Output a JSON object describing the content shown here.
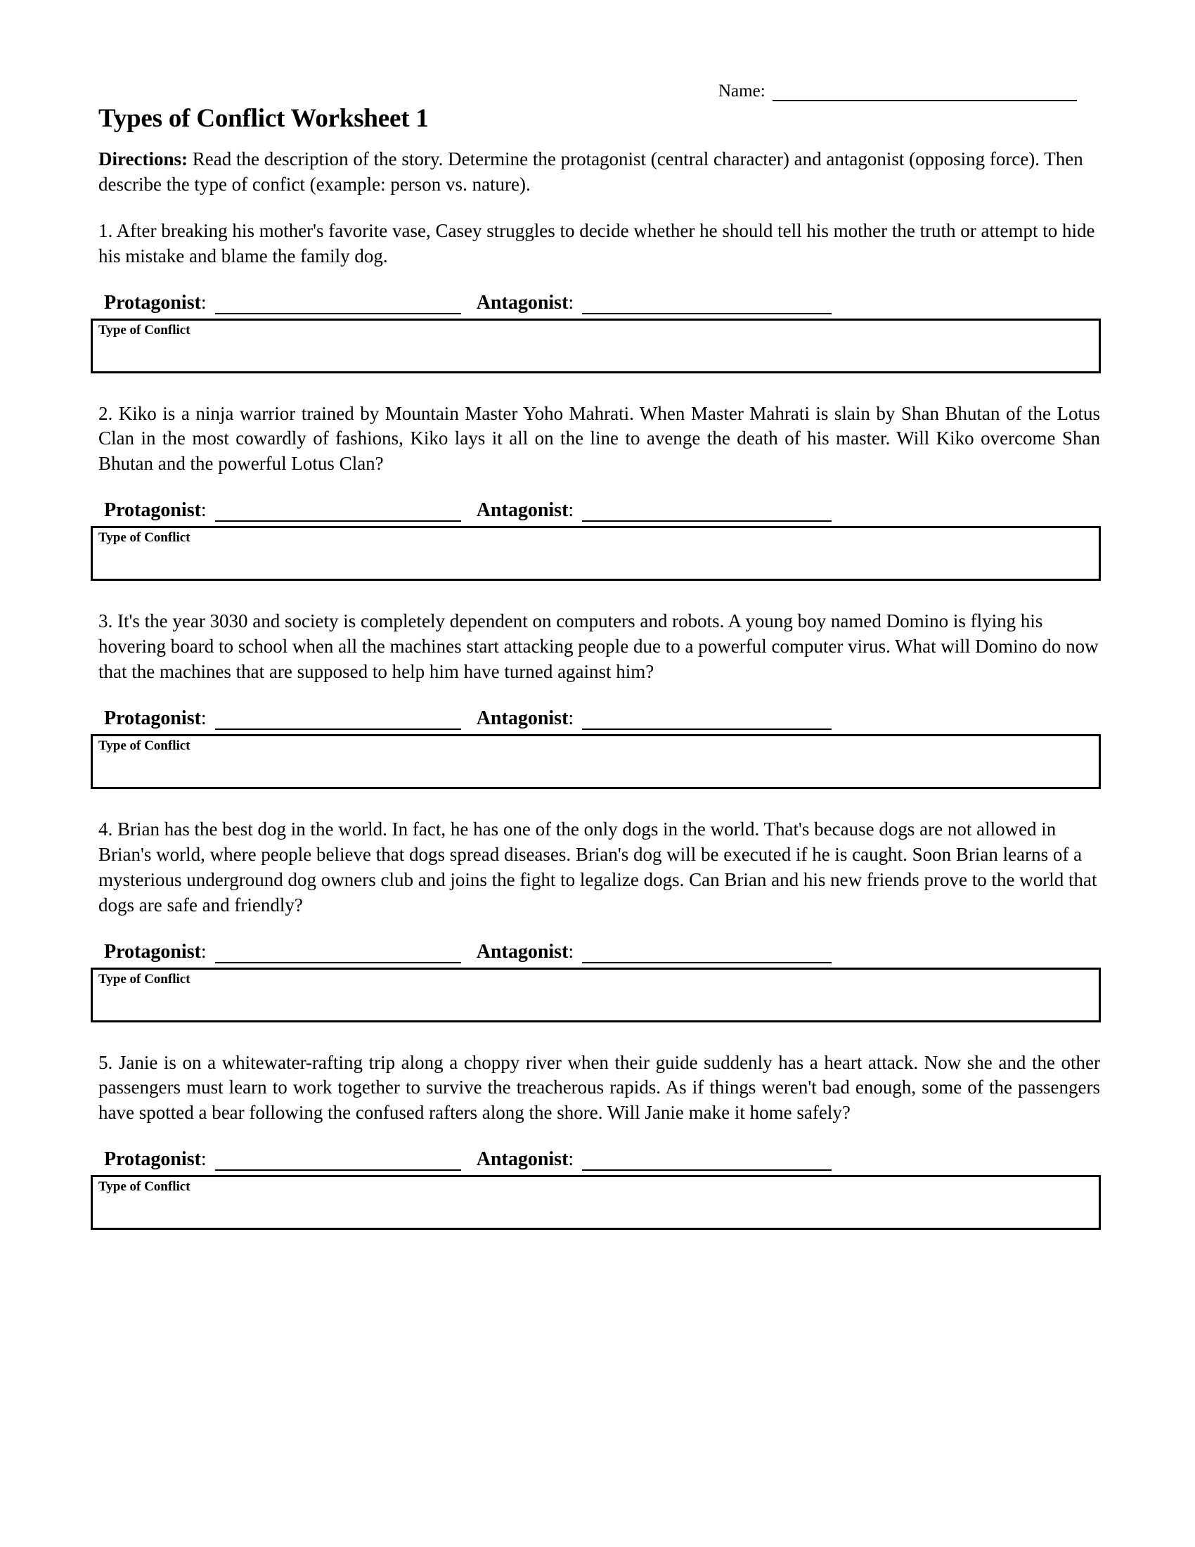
{
  "header": {
    "name_label": "Name:"
  },
  "title": "Types of Conflict Worksheet 1",
  "directions": {
    "label": "Directions:",
    "text": " Read the description of the story. Determine the protagonist (central character) and antagonist (opposing force). Then describe the type of confict (example: person vs. nature)."
  },
  "fields": {
    "protagonist_label": "Protagonist",
    "antagonist_label": "Antagonist",
    "colon": ":",
    "conflict_box_label": "Type of Conflict"
  },
  "questions": [
    {
      "number": "1.",
      "text": "1. After breaking his mother's favorite vase, Casey struggles to decide whether he should tell his mother the truth or attempt to hide his mistake and blame the family dog."
    },
    {
      "number": "2.",
      "text": "2. Kiko is a ninja warrior trained by Mountain Master Yoho Mahrati. When Master Mahrati is slain by Shan Bhutan of the Lotus Clan in the most cowardly of fashions, Kiko lays it all on the line to avenge the death of his master. Will Kiko overcome Shan Bhutan and the powerful Lotus Clan?"
    },
    {
      "number": "3.",
      "text": "3. It's the year 3030 and society is completely dependent on computers and robots. A young boy named Domino is flying his hovering board to school when all the machines start attacking people due to a powerful computer virus. What will Domino do now that the machines that are supposed to help him have turned against him?"
    },
    {
      "number": "4.",
      "text": "4. Brian has the best dog in the world. In fact, he has one of the only dogs in the world. That's because dogs are not allowed in Brian's world, where people believe that dogs spread diseases. Brian's dog will be executed if he is caught. Soon Brian learns of a mysterious underground dog owners club and joins the fight to legalize dogs. Can Brian and his new friends prove to the world that dogs are safe and friendly?"
    },
    {
      "number": "5.",
      "text": "5. Janie is on a whitewater-rafting trip along a choppy river when their guide suddenly has a heart attack. Now she and the other passengers must learn to work together to survive the treacherous rapids. As if things weren't bad enough, some of the passengers have spotted a bear following the confused rafters along the shore. Will Janie make it home safely?"
    }
  ],
  "colors": {
    "text": "#000000",
    "background": "#ffffff",
    "rule": "#000000"
  }
}
